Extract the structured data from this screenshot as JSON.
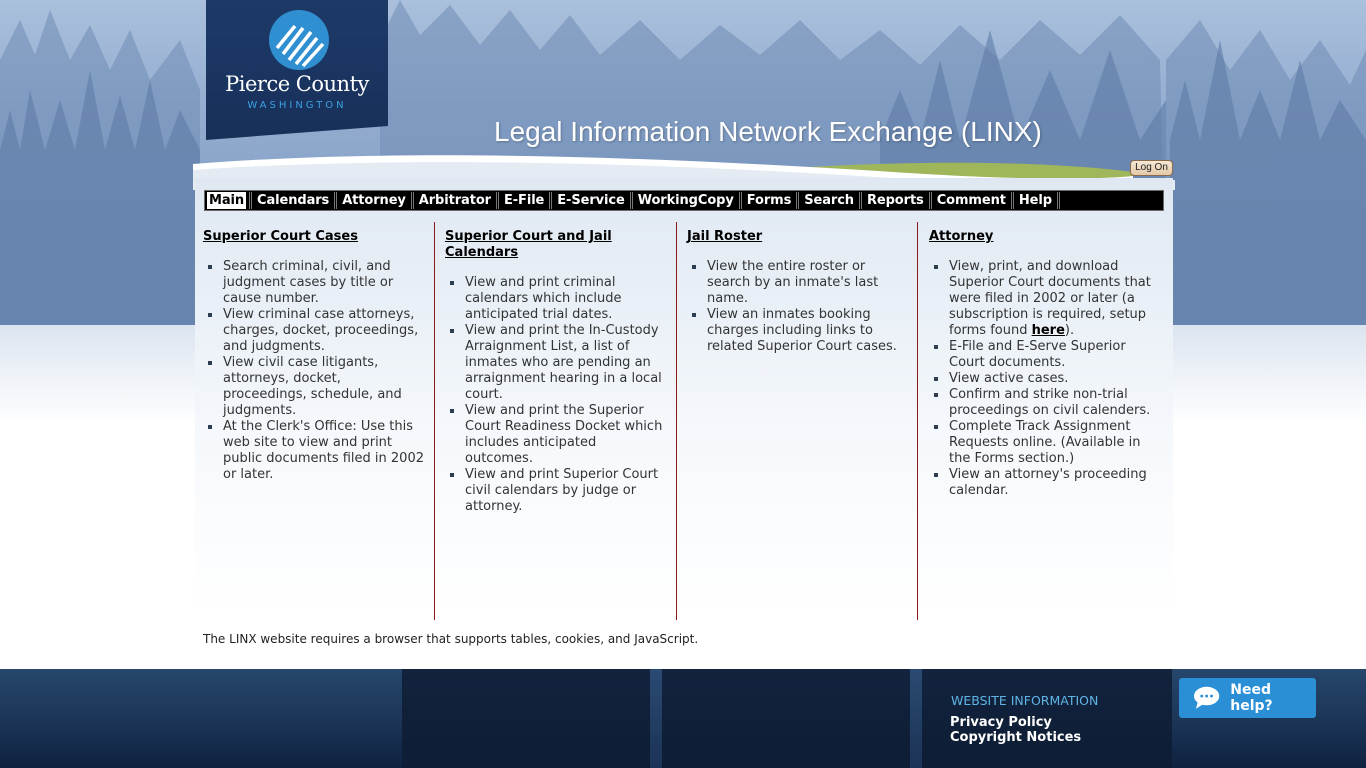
{
  "header": {
    "logo": {
      "name": "Pierce County",
      "state": "WASHINGTON"
    },
    "title": "Legal Information Network Exchange (LINX)",
    "logon_label": "Log On"
  },
  "nav": {
    "items": [
      {
        "label": "Main",
        "active": true
      },
      {
        "label": "Calendars"
      },
      {
        "label": "Attorney"
      },
      {
        "label": "Arbitrator"
      },
      {
        "label": "E-File"
      },
      {
        "label": "E-Service"
      },
      {
        "label": "WorkingCopy"
      },
      {
        "label": "Forms"
      },
      {
        "label": "Search"
      },
      {
        "label": "Reports"
      },
      {
        "label": "Comment"
      },
      {
        "label": "Help"
      }
    ]
  },
  "columns": [
    {
      "title": "Superior Court Cases",
      "items": [
        "Search criminal, civil, and judgment cases by title or cause number.",
        "View criminal case attorneys, charges, docket, proceedings, and judgments.",
        "View civil case litigants, attorneys, docket, proceedings, schedule, and judgments.",
        "At the Clerk's Office: Use this web site to view and print public documents filed in 2002 or later."
      ]
    },
    {
      "title": "Superior Court and Jail Calendars",
      "items": [
        "View and print criminal calendars which include anticipated trial dates.",
        "View and print the In-Custody Arraignment List, a list of inmates who are pending an arraignment hearing in a local court.",
        "View and print the Superior Court Readiness Docket which includes anticipated outcomes.",
        "View and print Superior Court civil calendars by judge or attorney."
      ]
    },
    {
      "title": "Jail Roster",
      "items": [
        "View the entire roster or search by an inmate's last name.",
        "View an inmates booking charges including links to related Superior Court cases."
      ]
    },
    {
      "title": "Attorney",
      "items": [
        {
          "before": "View, print, and download Superior Court documents that were filed in 2002 or later (a subscription is required, setup forms found ",
          "link": "here",
          "after": ")."
        },
        "E-File and E-Serve Superior Court documents.",
        "View active cases.",
        "Confirm and strike non-trial proceedings on civil calenders.",
        "Complete Track Assignment Requests online. (Available in the Forms section.)",
        "View an attorney's proceeding calendar."
      ]
    }
  ],
  "requirements_note": "The LINX website requires a browser that supports tables, cookies, and JavaScript.",
  "footer": {
    "heading": "WEBSITE INFORMATION",
    "links": [
      "Privacy Policy",
      "Copyright Notices"
    ],
    "help_button": "Need help?",
    "colors": {
      "help_button": "#2b8fd6",
      "heading": "#5fb4e6"
    }
  }
}
